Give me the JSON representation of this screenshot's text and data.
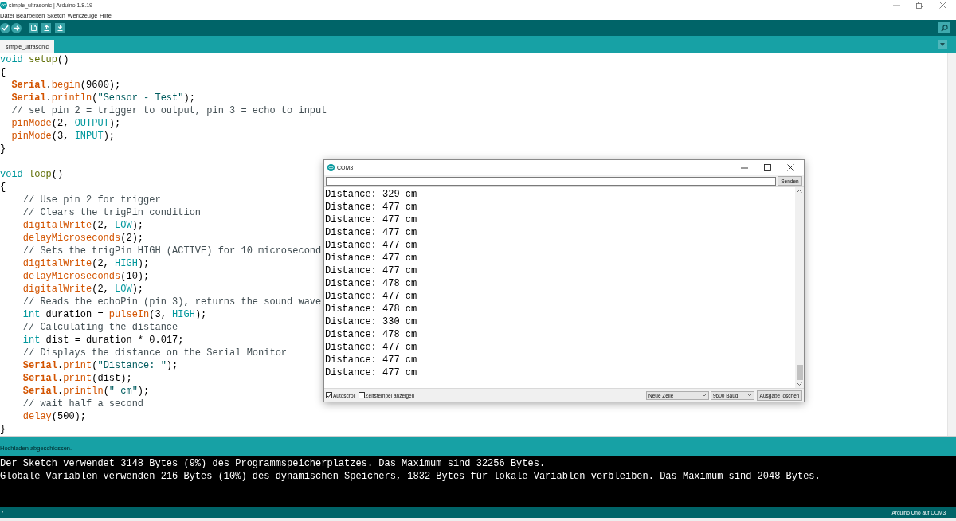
{
  "window": {
    "title": "simple_ultrasonic | Arduino 1.8.19"
  },
  "menu": [
    "Datei",
    "Bearbeiten",
    "Sketch",
    "Werkzeuge",
    "Hilfe"
  ],
  "tabs": [
    {
      "label": "simple_ultrasonic",
      "selected": true
    }
  ],
  "editor": {
    "blocks": [
      {
        "lines": [
          [
            {
              "text": "void",
              "kind": "type"
            },
            {
              "text": " setup",
              "kind": "builtin"
            },
            {
              "text": "()",
              "kind": "plain"
            }
          ],
          [
            {
              "text": "{",
              "kind": "plain"
            }
          ],
          [
            {
              "text": "  Serial",
              "kind": "class"
            },
            {
              "text": ".",
              "kind": "plain"
            },
            {
              "text": "begin",
              "kind": "function"
            },
            {
              "text": "(9600);",
              "kind": "plain"
            }
          ],
          [
            {
              "text": "  Serial",
              "kind": "class"
            },
            {
              "text": ".",
              "kind": "plain"
            },
            {
              "text": "println",
              "kind": "function"
            },
            {
              "text": "(",
              "kind": "plain"
            },
            {
              "text": "\"Sensor - Test\"",
              "kind": "string"
            },
            {
              "text": ");",
              "kind": "plain"
            }
          ],
          [
            {
              "text": "  // set pin 2 = trigger to output, pin 3 = echo to input",
              "kind": "comment"
            }
          ],
          [
            {
              "text": "  pinMode",
              "kind": "function"
            },
            {
              "text": "(2, ",
              "kind": "plain"
            },
            {
              "text": "OUTPUT",
              "kind": "constant"
            },
            {
              "text": ");",
              "kind": "plain"
            }
          ],
          [
            {
              "text": "  pinMode",
              "kind": "function"
            },
            {
              "text": "(3, ",
              "kind": "plain"
            },
            {
              "text": "INPUT",
              "kind": "constant"
            },
            {
              "text": ");",
              "kind": "plain"
            }
          ],
          [
            {
              "text": "}",
              "kind": "plain"
            }
          ]
        ]
      },
      {
        "lines": [
          [
            {
              "text": "void",
              "kind": "type"
            },
            {
              "text": " loop",
              "kind": "builtin"
            },
            {
              "text": "()",
              "kind": "plain"
            }
          ],
          [
            {
              "text": "{",
              "kind": "plain"
            }
          ],
          [
            {
              "text": "    // Use pin 2 for trigger",
              "kind": "comment"
            }
          ],
          [
            {
              "text": "    // Clears the trigPin condition",
              "kind": "comment"
            }
          ],
          [
            {
              "text": "    digitalWrite",
              "kind": "function"
            },
            {
              "text": "(2, ",
              "kind": "plain"
            },
            {
              "text": "LOW",
              "kind": "constant"
            },
            {
              "text": ");",
              "kind": "plain"
            }
          ],
          [
            {
              "text": "    delayMicroseconds",
              "kind": "function"
            },
            {
              "text": "(2);",
              "kind": "plain"
            }
          ],
          [
            {
              "text": "    // Sets the trigPin HIGH (ACTIVE) for 10 microsecond",
              "kind": "comment"
            }
          ],
          [
            {
              "text": "    digitalWrite",
              "kind": "function"
            },
            {
              "text": "(2, ",
              "kind": "plain"
            },
            {
              "text": "HIGH",
              "kind": "constant"
            },
            {
              "text": ");",
              "kind": "plain"
            }
          ],
          [
            {
              "text": "    delayMicroseconds",
              "kind": "function"
            },
            {
              "text": "(10);",
              "kind": "plain"
            }
          ],
          [
            {
              "text": "    digitalWrite",
              "kind": "function"
            },
            {
              "text": "(2, ",
              "kind": "plain"
            },
            {
              "text": "LOW",
              "kind": "constant"
            },
            {
              "text": ");",
              "kind": "plain"
            }
          ],
          [
            {
              "text": "    // Reads the echoPin (pin 3), returns the sound wave",
              "kind": "comment"
            }
          ],
          [
            {
              "text": "    int",
              "kind": "type"
            },
            {
              "text": " duration = ",
              "kind": "plain"
            },
            {
              "text": "pulseIn",
              "kind": "function"
            },
            {
              "text": "(3, ",
              "kind": "plain"
            },
            {
              "text": "HIGH",
              "kind": "constant"
            },
            {
              "text": ");",
              "kind": "plain"
            }
          ],
          [
            {
              "text": "    // Calculating the distance",
              "kind": "comment"
            }
          ],
          [
            {
              "text": "    int",
              "kind": "type"
            },
            {
              "text": " dist = duration * 0.017;",
              "kind": "plain"
            }
          ],
          [
            {
              "text": "    // Displays the distance on the Serial Monitor",
              "kind": "comment"
            }
          ],
          [
            {
              "text": "    Serial",
              "kind": "class"
            },
            {
              "text": ".",
              "kind": "plain"
            },
            {
              "text": "print",
              "kind": "function"
            },
            {
              "text": "(",
              "kind": "plain"
            },
            {
              "text": "\"Distance: \"",
              "kind": "string"
            },
            {
              "text": ");",
              "kind": "plain"
            }
          ],
          [
            {
              "text": "    Serial",
              "kind": "class"
            },
            {
              "text": ".",
              "kind": "plain"
            },
            {
              "text": "print",
              "kind": "function"
            },
            {
              "text": "(dist);",
              "kind": "plain"
            }
          ],
          [
            {
              "text": "    Serial",
              "kind": "class"
            },
            {
              "text": ".",
              "kind": "plain"
            },
            {
              "text": "println",
              "kind": "function"
            },
            {
              "text": "(",
              "kind": "plain"
            },
            {
              "text": "\" cm\"",
              "kind": "string"
            },
            {
              "text": ");",
              "kind": "plain"
            }
          ],
          [
            {
              "text": "    // wait half a second",
              "kind": "comment"
            }
          ],
          [
            {
              "text": "    delay",
              "kind": "function"
            },
            {
              "text": "(500);",
              "kind": "plain"
            }
          ],
          [
            {
              "text": "}",
              "kind": "plain"
            }
          ]
        ]
      }
    ]
  },
  "serial_monitor": {
    "title": "COM3",
    "send_button": "Senden",
    "output": [
      "Distance: 329 cm",
      "Distance: 477 cm",
      "Distance: 477 cm",
      "Distance: 477 cm",
      "Distance: 477 cm",
      "Distance: 477 cm",
      "Distance: 477 cm",
      "Distance: 478 cm",
      "Distance: 477 cm",
      "Distance: 478 cm",
      "Distance: 330 cm",
      "Distance: 478 cm",
      "Distance: 477 cm",
      "Distance: 477 cm",
      "Distance: 477 cm"
    ],
    "options": [
      {
        "label": "Autoscroll",
        "checked": true
      },
      {
        "label": "Zeitstempel anzeigen",
        "checked": false
      }
    ],
    "line_ending": "Neue Zeile",
    "baud_rate": "9600 Baud",
    "clear_button": "Ausgabe löschen"
  },
  "message": "Hochladen abgeschlossen.",
  "console": [
    "Der Sketch verwendet 3148 Bytes (9%) des Programmspeicherplatzes. Das Maximum sind 32256 Bytes.",
    "Globale Variablen verwenden 216 Bytes (10%) des dynamischen Speichers, 1832 Bytes für lokale Variablen verbleiben. Das Maximum sind 2048 Bytes."
  ],
  "status_bar": {
    "line": "7",
    "board": "Arduino Uno auf COM3"
  }
}
